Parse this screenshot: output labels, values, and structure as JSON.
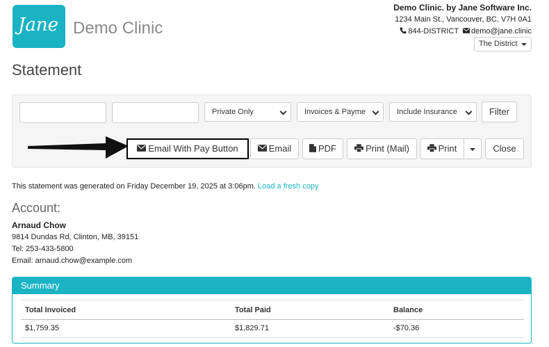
{
  "header": {
    "logo_text": "Jane",
    "clinic_name": "Demo Clinic",
    "company_name": "Demo Clinic. by Jane Software Inc.",
    "address": "1234 Main St., Vancouver, BC, V7H 0A1",
    "phone": "844-DISTRICT",
    "email": "demo@jane.clinic",
    "location_selected": "The District"
  },
  "page": {
    "title": "Statement"
  },
  "filters": {
    "input1_value": "",
    "input2_value": "",
    "visibility_selected": "Private Only",
    "transactions_selected": "Invoices & Payme",
    "insurance_selected": "Include Insurance",
    "filter_label": "Filter"
  },
  "actions": {
    "email_pay_label": "Email With Pay Button",
    "email_label": "Email",
    "pdf_label": "PDF",
    "print_mail_label": "Print (Mail)",
    "print_label": "Print",
    "close_label": "Close"
  },
  "generated": {
    "text": "This statement was generated on Friday December 19, 2025 at 3:06pm.",
    "link": "Load a fresh copy"
  },
  "account": {
    "heading": "Account:",
    "name": "Arnaud Chow",
    "address": "9814 Dundas Rd, Clinton, MB, 39151",
    "tel": "Tel: 253-433-5800",
    "email": "Email: arnaud.chow@example.com"
  },
  "summary": {
    "title": "Summary",
    "headers": [
      "Total Invoiced",
      "Total Paid",
      "Balance"
    ],
    "values": [
      "$1,759.35",
      "$1,829.71",
      "-$70.36"
    ]
  },
  "colors": {
    "accent": "#1ab3c4",
    "highlight_border": "#000000"
  },
  "icons": [
    "phone-icon",
    "envelope-icon",
    "file-icon",
    "print-icon",
    "caret-down-icon",
    "arrow-icon"
  ]
}
